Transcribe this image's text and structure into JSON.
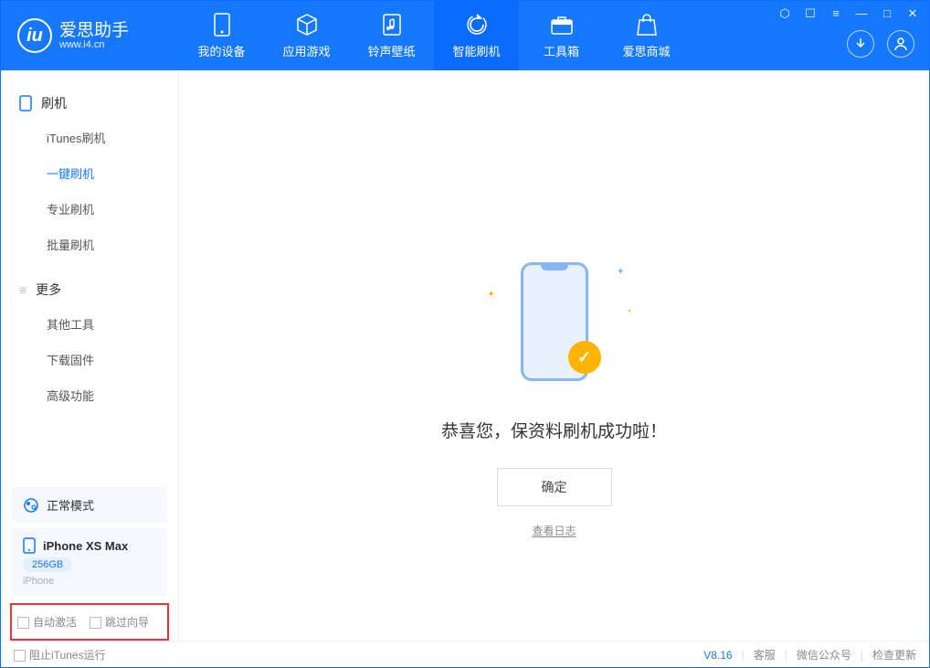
{
  "header": {
    "logo_title": "爱思助手",
    "logo_sub": "www.i4.cn",
    "tabs": [
      {
        "label": "我的设备",
        "icon": "device"
      },
      {
        "label": "应用游戏",
        "icon": "cube"
      },
      {
        "label": "铃声壁纸",
        "icon": "music"
      },
      {
        "label": "智能刷机",
        "icon": "refresh",
        "active": true
      },
      {
        "label": "工具箱",
        "icon": "toolbox"
      },
      {
        "label": "爱思商城",
        "icon": "bag"
      }
    ]
  },
  "sidebar": {
    "groups": [
      {
        "title": "刷机",
        "icon": "phone",
        "items": [
          "iTunes刷机",
          "一键刷机",
          "专业刷机",
          "批量刷机"
        ],
        "active_index": 1
      },
      {
        "title": "更多",
        "icon": "menu",
        "items": [
          "其他工具",
          "下载固件",
          "高级功能"
        ]
      }
    ],
    "mode_label": "正常模式",
    "device": {
      "name": "iPhone XS Max",
      "storage": "256GB",
      "type": "iPhone"
    },
    "checkboxes": {
      "auto_activate": "自动激活",
      "skip_guide": "跳过向导"
    }
  },
  "main": {
    "success_text": "恭喜您，保资料刷机成功啦！",
    "ok_button": "确定",
    "log_link": "查看日志"
  },
  "footer": {
    "block_itunes": "阻止iTunes运行",
    "version": "V8.16",
    "links": [
      "客服",
      "微信公众号",
      "检查更新"
    ]
  }
}
